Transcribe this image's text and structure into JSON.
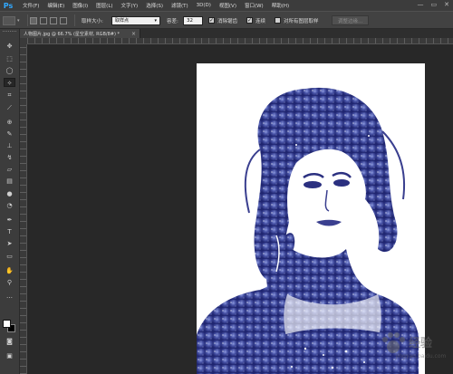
{
  "app": {
    "logo": "Ps"
  },
  "menu": [
    "文件(F)",
    "编辑(E)",
    "图像(I)",
    "图层(L)",
    "文字(Y)",
    "选择(S)",
    "滤镜(T)",
    "3D(D)",
    "视图(V)",
    "窗口(W)",
    "帮助(H)"
  ],
  "window_controls": {
    "minimize": "—",
    "restore": "▭",
    "close": "✕"
  },
  "options": {
    "sample_size_label": "取样大小:",
    "sample_size_value": "取样点",
    "tolerance_label": "容差:",
    "tolerance_value": "32",
    "antialias_label": "消除锯齿",
    "antialias_checked": true,
    "contiguous_label": "连续",
    "contiguous_checked": true,
    "sample_all_label": "对所有图层取样",
    "sample_all_checked": false,
    "refine_edge_label": "调整边缘..."
  },
  "document": {
    "tab_title": "人物图片.jpg @ 66.7% (星空素材, RGB/8#) *",
    "close_glyph": "×"
  },
  "tools": [
    "move-icon",
    "marquee-icon",
    "lasso-icon",
    "quick-select-icon",
    "crop-icon",
    "eyedropper-icon",
    "healing-icon",
    "brush-icon",
    "stamp-icon",
    "history-brush-icon",
    "eraser-icon",
    "gradient-icon",
    "blur-icon",
    "dodge-icon",
    "pen-icon",
    "type-icon",
    "path-select-icon",
    "shape-icon",
    "hand-icon",
    "zoom-icon"
  ],
  "colors": {
    "foreground": "#ffffff",
    "background": "#000000",
    "accent": "#31a8ff",
    "starfield": "#3a3f8f"
  },
  "watermark": {
    "text": "经验",
    "sub": "jingyan.baidu.com"
  }
}
